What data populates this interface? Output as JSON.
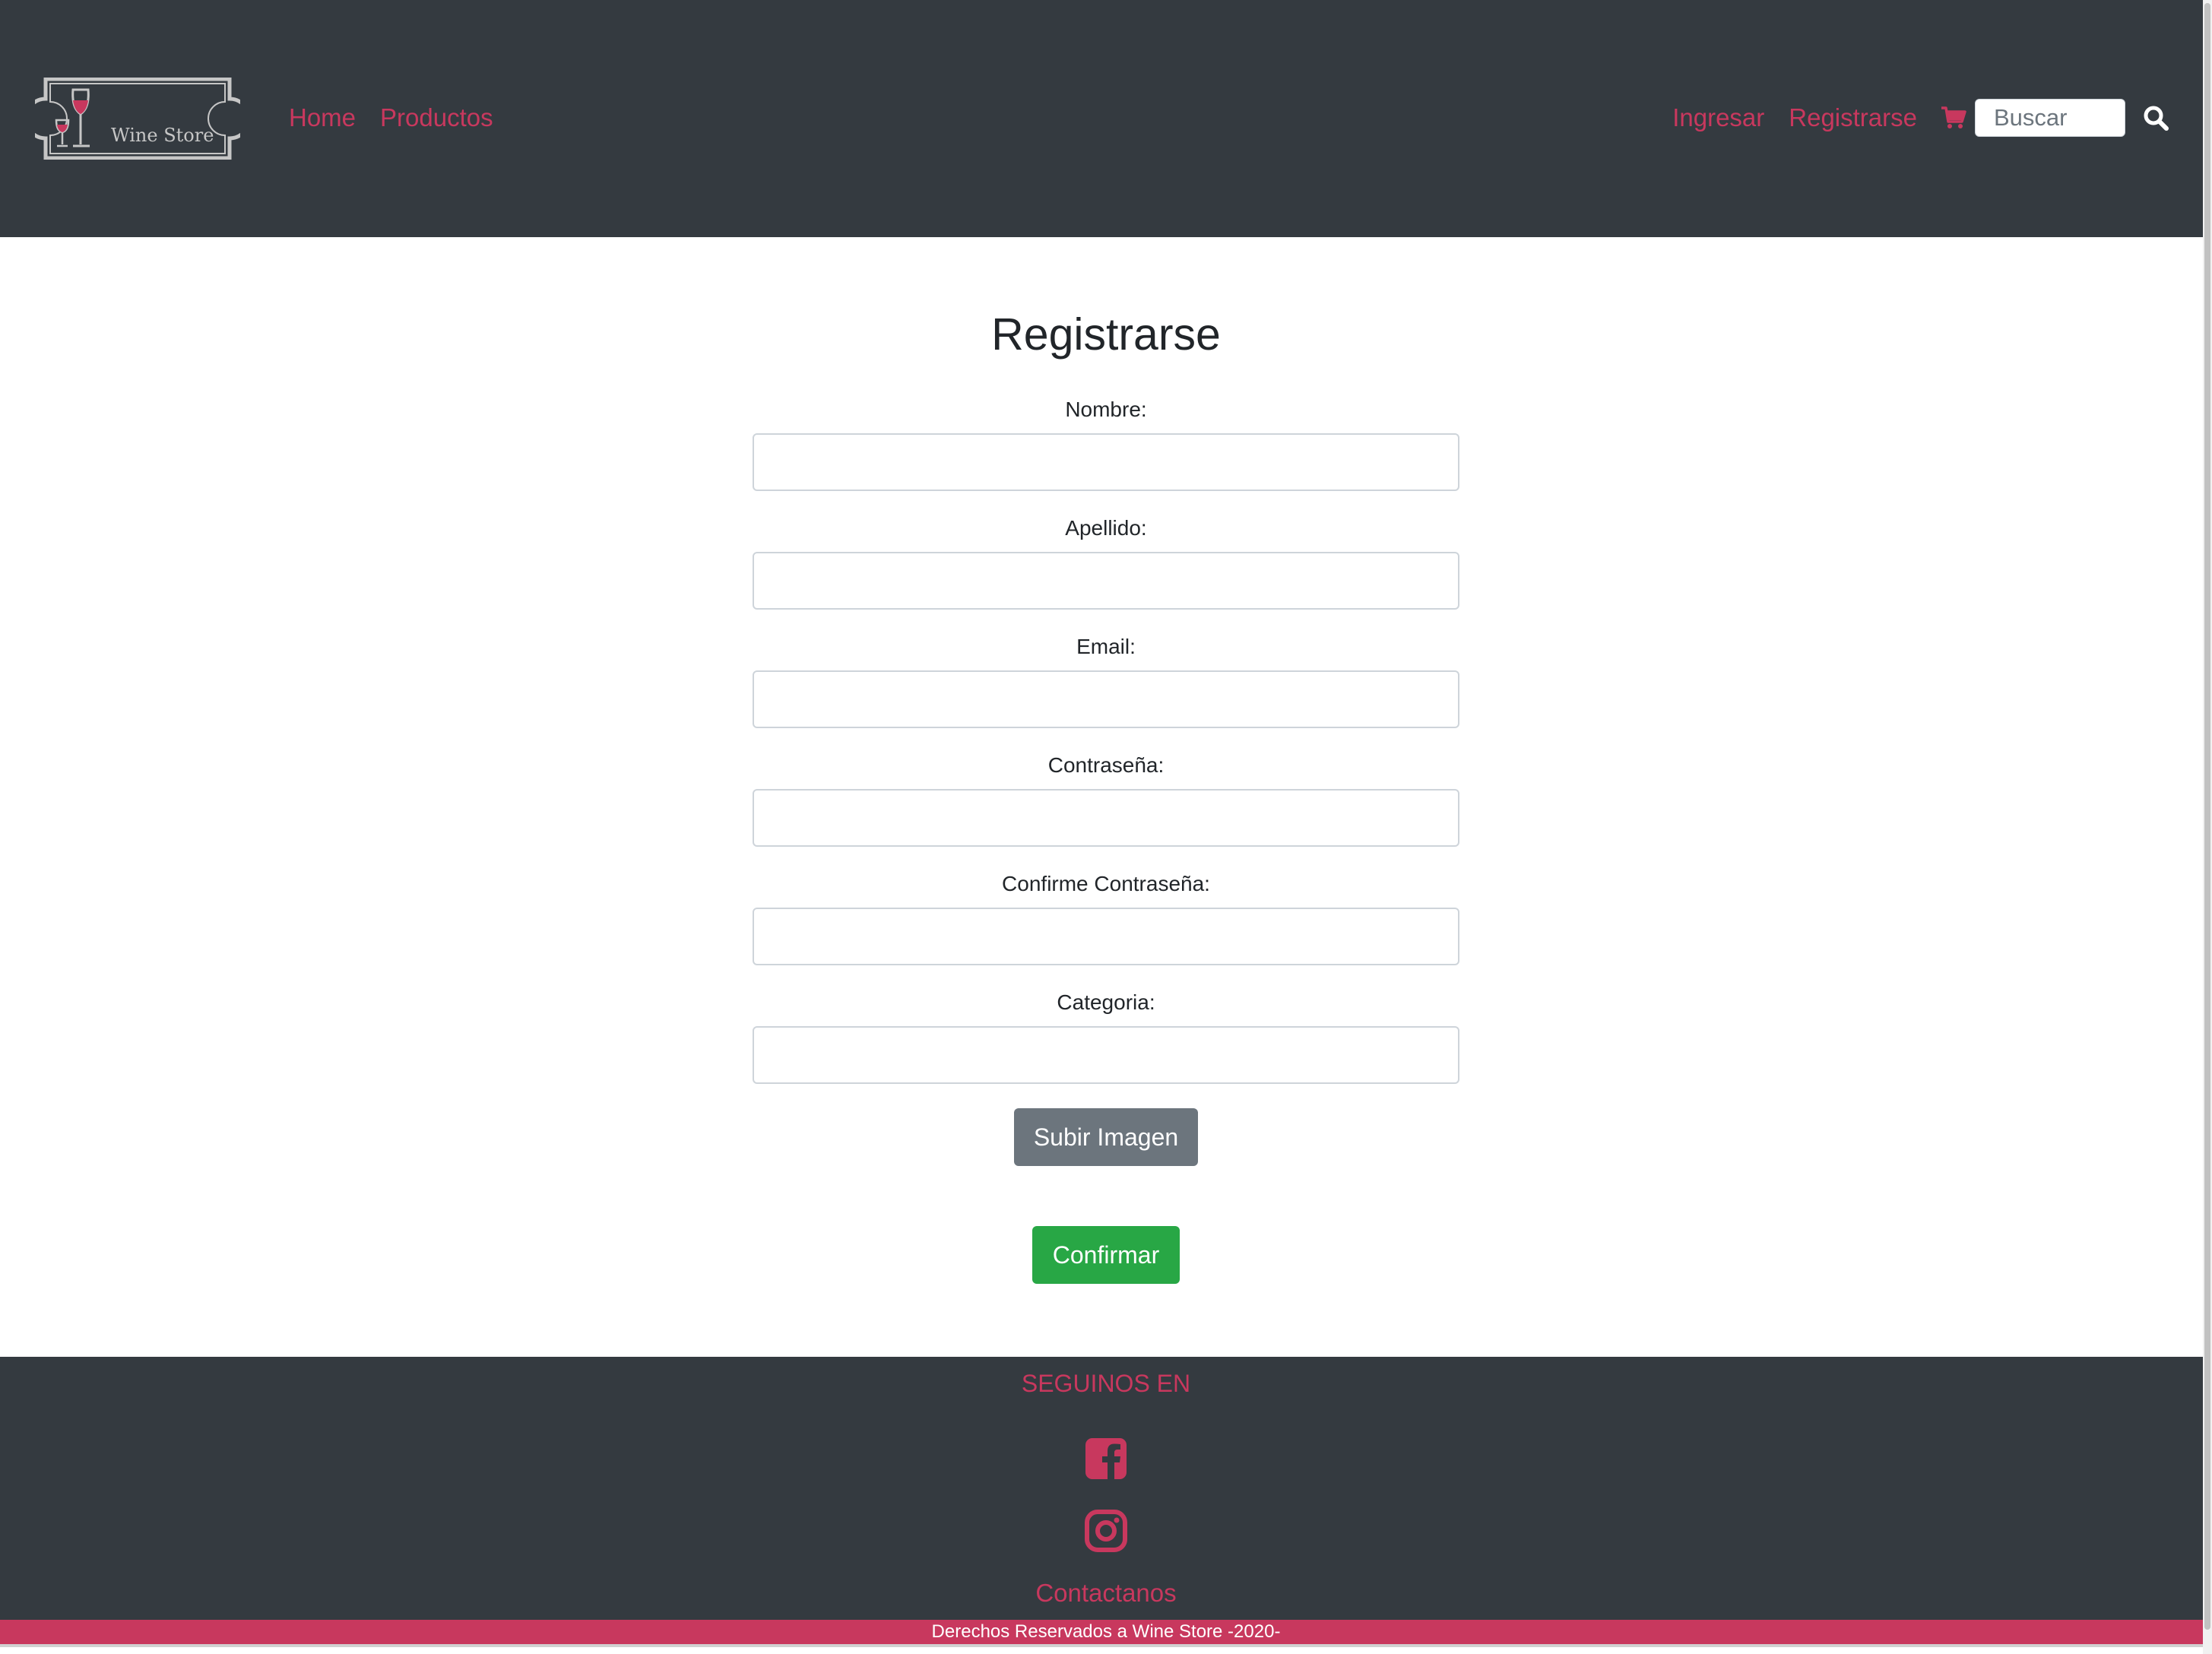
{
  "header": {
    "logo_text": "Wine Store",
    "nav_left": [
      {
        "label": "Home"
      },
      {
        "label": "Productos"
      }
    ],
    "nav_right": [
      {
        "label": "Ingresar"
      },
      {
        "label": "Registrarse"
      }
    ],
    "search": {
      "placeholder": "Buscar",
      "value": ""
    },
    "icons": [
      "cart-icon",
      "search-icon"
    ]
  },
  "form": {
    "title": "Registrarse",
    "fields": [
      {
        "label": "Nombre:",
        "value": ""
      },
      {
        "label": "Apellido:",
        "value": ""
      },
      {
        "label": "Email:",
        "value": ""
      },
      {
        "label": "Contraseña:",
        "value": ""
      },
      {
        "label": "Confirme Contraseña:",
        "value": ""
      },
      {
        "label": "Categoria:",
        "value": ""
      }
    ],
    "upload_label": "Subir Imagen",
    "confirm_label": "Confirmar"
  },
  "footer": {
    "heading": "SEGUINOS EN",
    "social_icons": [
      "facebook-icon",
      "instagram-icon"
    ],
    "contact_label": "Contactanos",
    "copyright": "Derechos Reservados a Wine Store -2020-"
  },
  "colors": {
    "navbar_bg": "#343a40",
    "accent": "#c8385e",
    "upload_button": "#6c757d",
    "confirm_button": "#28a745"
  }
}
